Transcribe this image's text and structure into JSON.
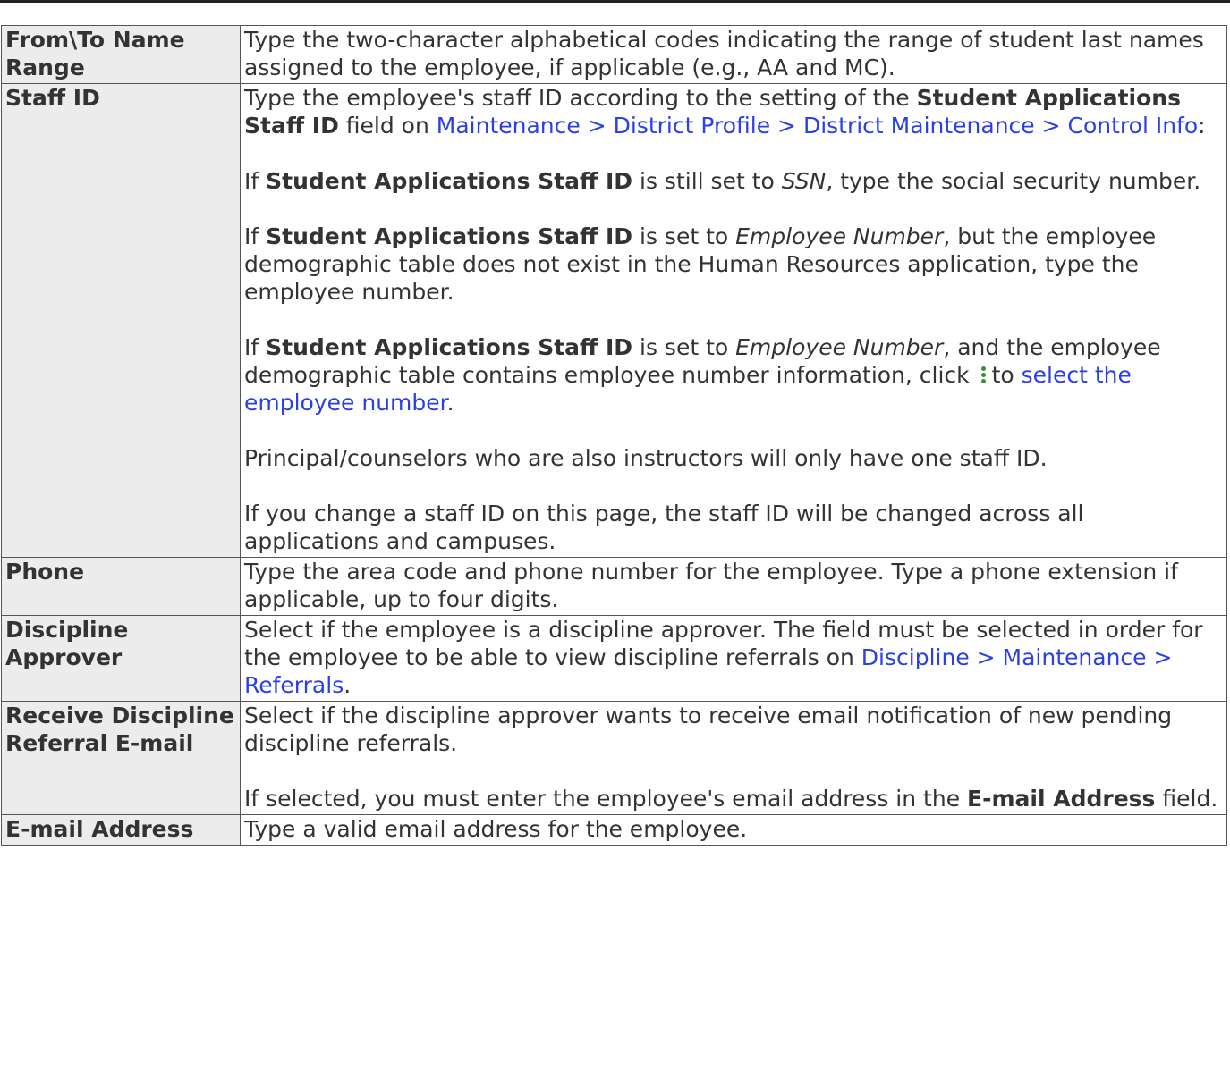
{
  "rows": [
    {
      "label": "From\\To Name Range",
      "text": "Type the two-character alphabetical codes indicating the range of student last names assigned to the employee, if applicable (e.g., AA and MC)."
    },
    {
      "label": "Staff ID",
      "p1_a": "Type the employee's staff ID according to the setting of the ",
      "p1_kw": "Student Applications Staff ID",
      "p1_b": " field on ",
      "p1_link": "Maintenance > District Profile > District Maintenance > Control Info",
      "p1_c": ":",
      "p2_a": "If ",
      "p2_kw": "Student Applications Staff ID",
      "p2_b": " is still set to ",
      "p2_it": "SSN",
      "p2_c": ", type the social security number.",
      "p3_a": "If ",
      "p3_kw": "Student Applications Staff ID",
      "p3_b": " is set to ",
      "p3_it": "Employee Number",
      "p3_c": ", but the employee demographic table does not exist in the Human Resources application, type the employee number.",
      "p4_a": "If ",
      "p4_kw": "Student Applications Staff ID",
      "p4_b": " is set to ",
      "p4_it": "Employee Number",
      "p4_c": ", and the employee demographic table contains employee number information, click ",
      "p4_d": "to ",
      "p4_link": "select the employee number",
      "p4_e": ".",
      "p5": "Principal/counselors who are also instructors will only have one staff ID.",
      "p6": "If you change a staff ID on this page, the staff ID will be changed across all applications and campuses.",
      "icon": "vertical-ellipsis-icon"
    },
    {
      "label": "Phone",
      "text": "Type the area code and phone number for the employee. Type a phone extension if applicable, up to four digits."
    },
    {
      "label": "Discipline Approver",
      "text_a": "Select if the employee is a discipline approver. The field must be selected in order for the employee to be able to view discipline referrals on ",
      "link": "Discipline > Maintenance > Referrals",
      "text_b": "."
    },
    {
      "label": "Receive Discipline Referral E-mail",
      "p1": "Select if the discipline approver wants to receive email notification of new pending discipline referrals.",
      "p2_a": "If selected, you must enter the employee's email address in the ",
      "p2_kw": "E-mail Address",
      "p2_b": " field."
    },
    {
      "label": "E-mail Address",
      "text": "Type a valid email address for the employee."
    }
  ],
  "colors": {
    "link": "#2b3fe6",
    "label_bg": "#ececec",
    "border": "#555555",
    "icon": "#3a8c3a"
  }
}
